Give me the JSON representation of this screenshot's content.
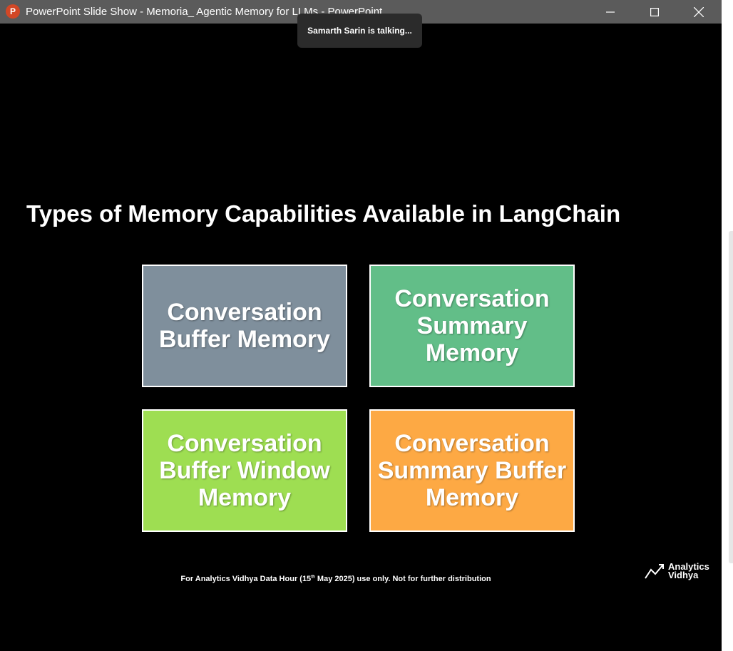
{
  "window": {
    "title": "PowerPoint Slide Show  -  Memoria_ Agentic Memory for LLMs - PowerPoint",
    "app_icon_letter": "P"
  },
  "toast": {
    "text": "Samarth Sarin is talking..."
  },
  "slide": {
    "title": "Types of Memory Capabilities Available in LangChain",
    "boxes": [
      {
        "label": "Conversation Buffer Memory",
        "color": "#7f8f9c"
      },
      {
        "label": "Conversation Summary Memory",
        "color": "#62be88"
      },
      {
        "label": "Conversation Buffer Window Memory",
        "color": "#9ede52"
      },
      {
        "label": "Conversation Summary Buffer Memory",
        "color": "#fda944"
      }
    ],
    "footer": {
      "before_sup": "For Analytics Vidhya Data Hour (15",
      "sup": "th",
      "after_sup": " May 2025) use only. Not for further distribution"
    },
    "logo": {
      "line1": "Analytics",
      "line2": "Vidhya"
    }
  }
}
